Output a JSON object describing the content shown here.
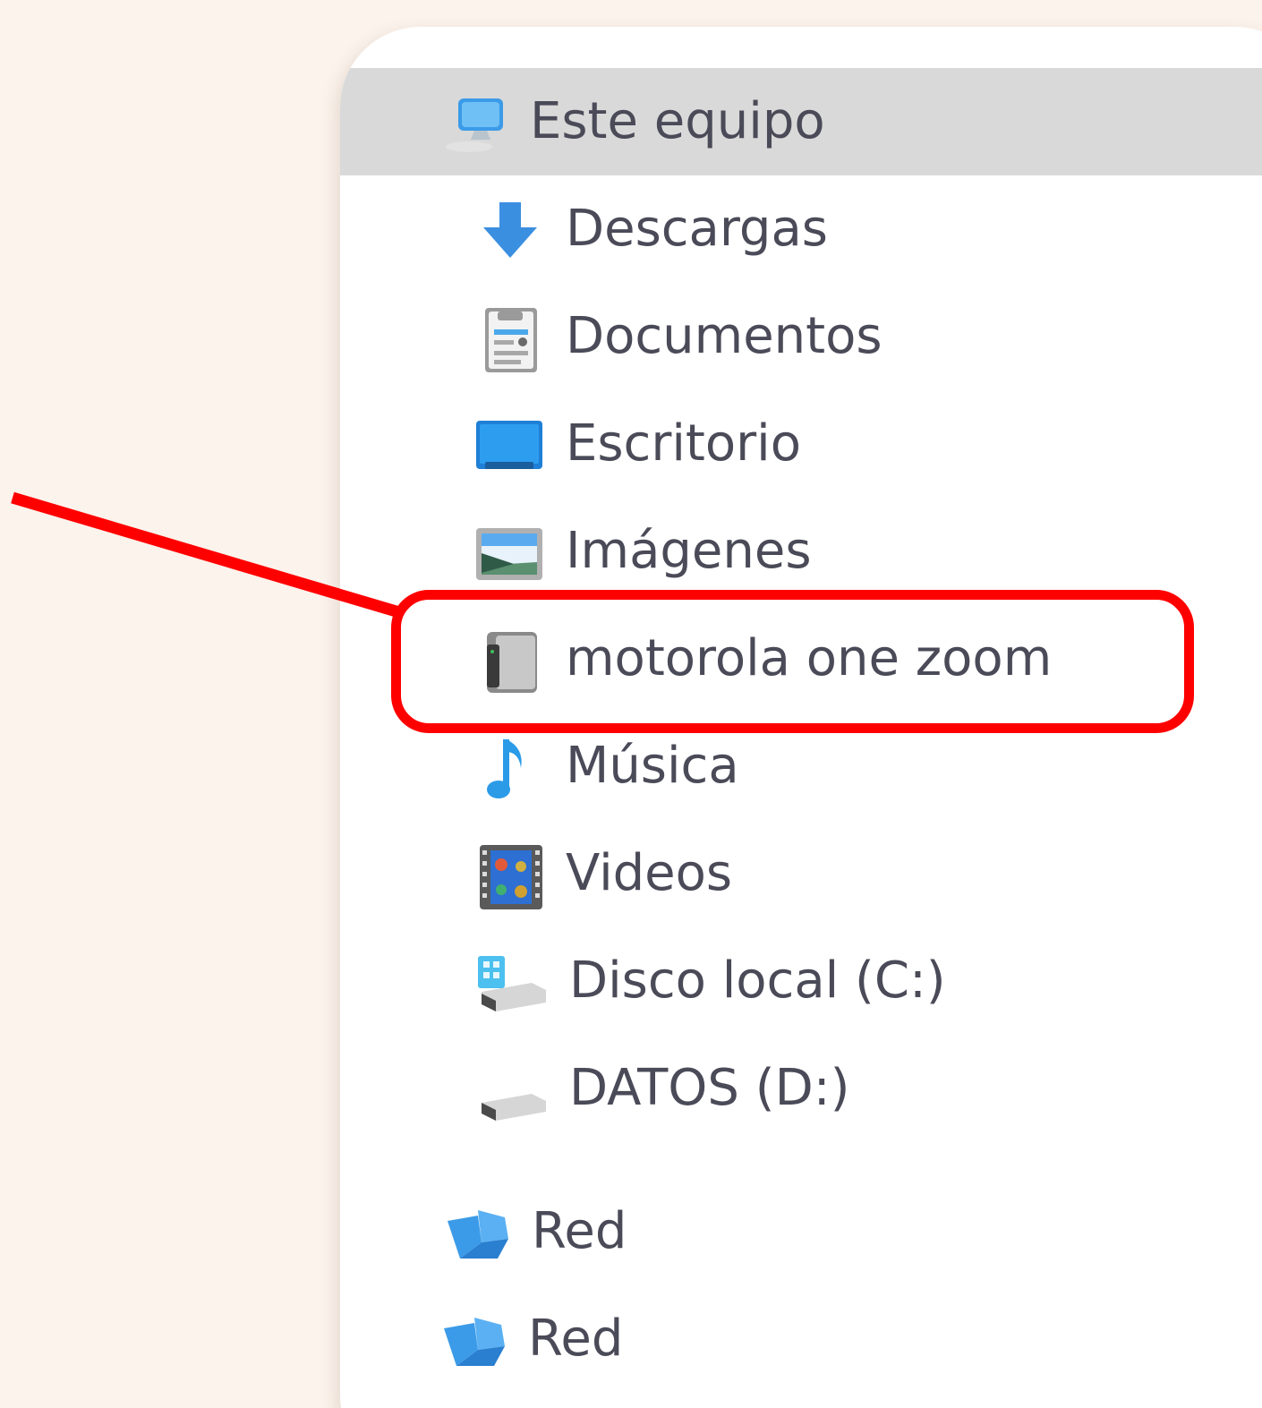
{
  "nav": {
    "items": [
      {
        "label": "Este equipo",
        "icon": "this-pc-icon",
        "selected": true
      },
      {
        "label": "Descargas",
        "icon": "downloads-icon"
      },
      {
        "label": "Documentos",
        "icon": "documents-icon"
      },
      {
        "label": "Escritorio",
        "icon": "desktop-icon"
      },
      {
        "label": "Imágenes",
        "icon": "pictures-icon"
      },
      {
        "label": "motorola one zoom",
        "icon": "phone-device-icon",
        "highlighted": true
      },
      {
        "label": "Música",
        "icon": "music-icon"
      },
      {
        "label": "Videos",
        "icon": "videos-icon"
      },
      {
        "label": "Disco local (C:)",
        "icon": "local-disk-icon"
      },
      {
        "label": "DATOS (D:)",
        "icon": "drive-icon"
      },
      {
        "label": "Red",
        "icon": "network-icon"
      },
      {
        "label": "Red",
        "icon": "network-icon"
      }
    ]
  },
  "annotation": {
    "color": "#ff0000",
    "target": "motorola one zoom"
  },
  "colors": {
    "background": "#fbf3ec",
    "panel": "#ffffff",
    "selected_row": "#d9d9d9",
    "text": "#4a4a58",
    "icon_blue": "#3b9be8"
  }
}
